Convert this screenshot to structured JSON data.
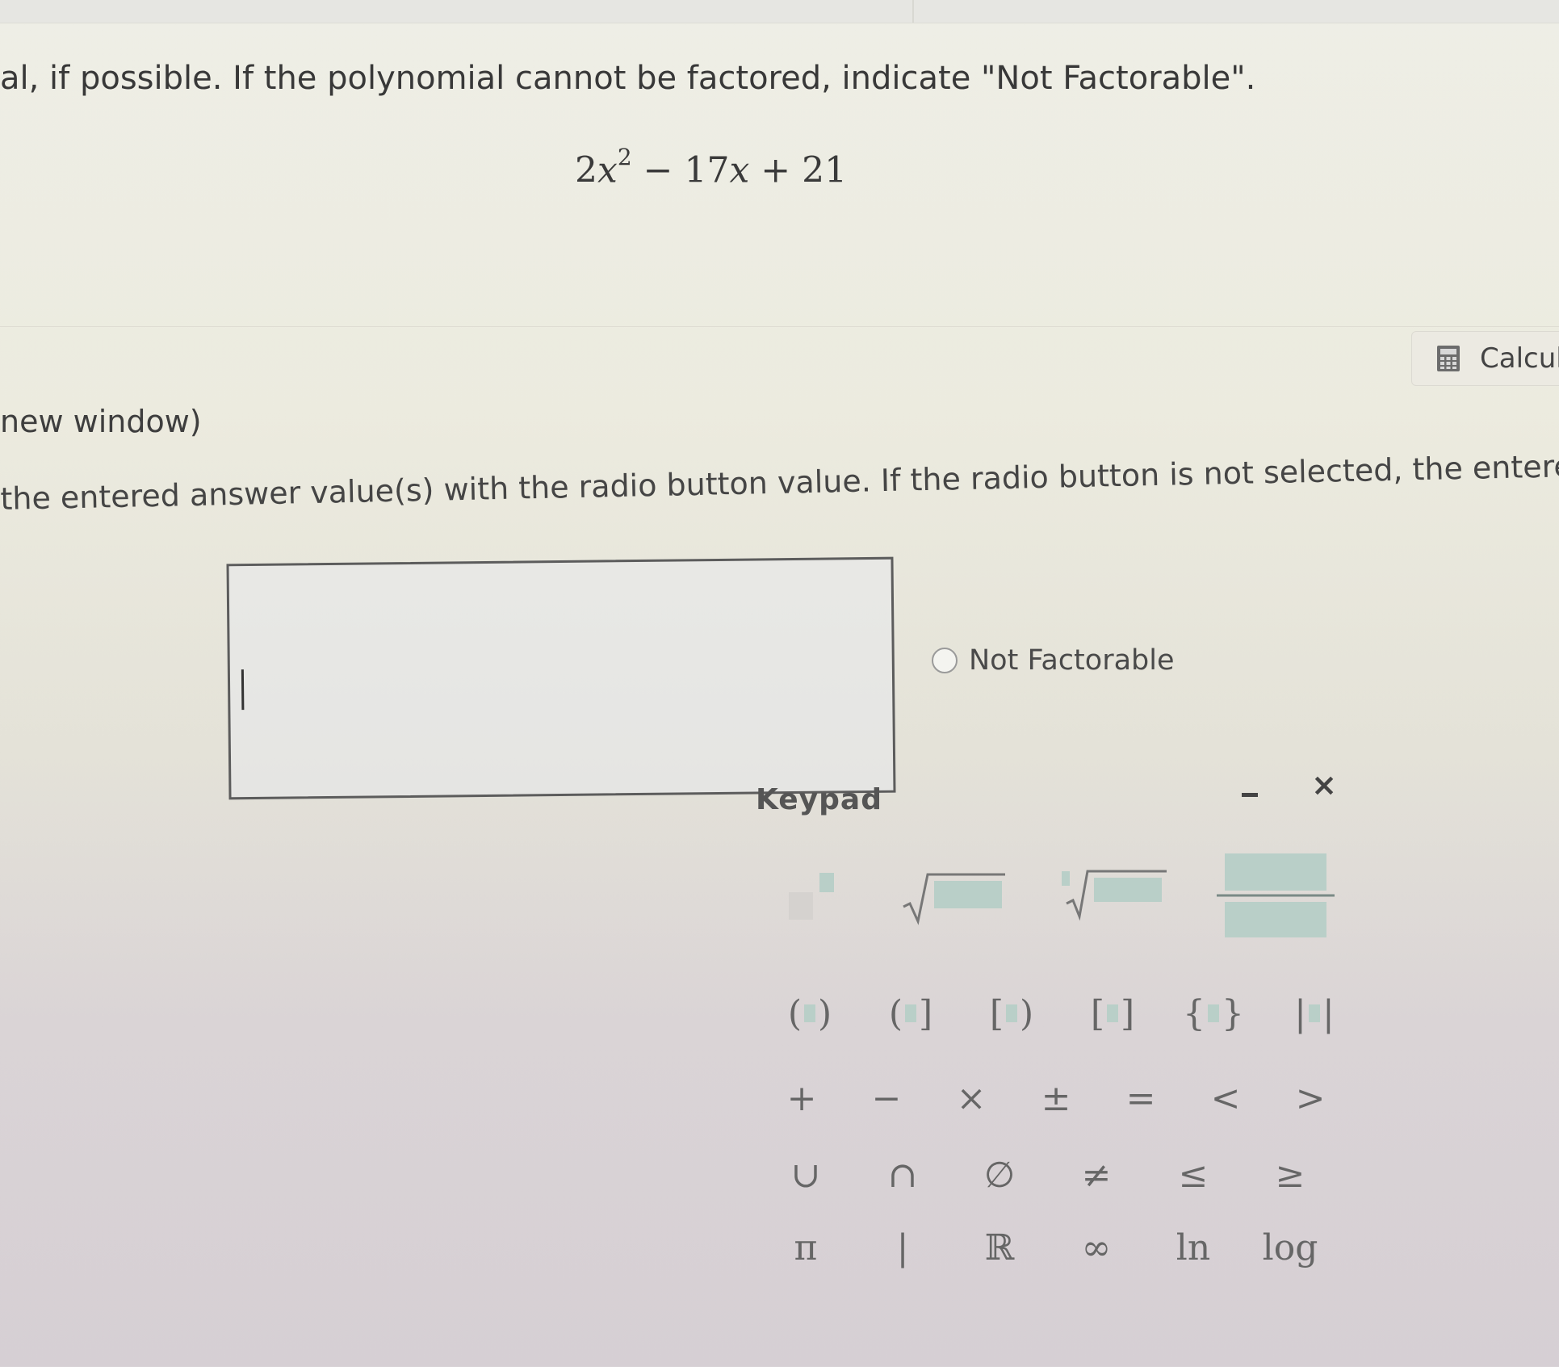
{
  "question": {
    "instruction": "al, if possible. If the polynomial cannot be factored, indicate \"Not Factorable\".",
    "expression": {
      "coef": "2",
      "var": "x",
      "exp": "2",
      "rest_a": " − 17",
      "rest_var": "x",
      "rest_b": " + 21"
    }
  },
  "calculator": {
    "label": "Calcul",
    "icon": "calculator-icon"
  },
  "link": {
    "new_window": "new window)"
  },
  "grading_note": "the entered answer value(s) with the radio button value. If the radio button is not selected, the entered answer is u",
  "answer": {
    "value": "",
    "radio_label": "Not Factorable"
  },
  "keypad": {
    "title": "Keypad",
    "minimize_icon": "minimize-icon",
    "close_icon": "close-icon",
    "template_row": [
      "superscript-template",
      "square-root-template",
      "nth-root-template",
      "fraction-template"
    ],
    "bracket_row": [
      "( )",
      "( ]",
      "[ )",
      "[ ]",
      "{ }",
      "| |"
    ],
    "operator_row": [
      "+",
      "−",
      "×",
      "±",
      "=",
      "<",
      ">"
    ],
    "set_row": [
      "∪",
      "∩",
      "∅",
      "≠",
      "≤",
      "≥"
    ],
    "const_row": [
      "π",
      "|",
      "ℝ",
      "∞",
      "ln",
      "log"
    ]
  },
  "colors": {
    "template_fill": "#b9cfc8",
    "border": "#5c5c5c"
  }
}
